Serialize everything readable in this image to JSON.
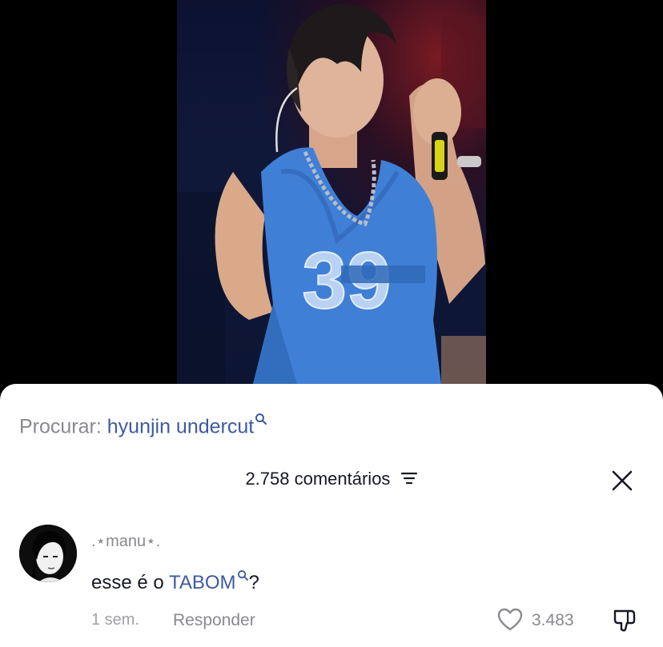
{
  "search": {
    "prefix": "Procurar:",
    "term": "hyunjin undercut"
  },
  "comments_header": {
    "count_label": "2.758 comentários"
  },
  "comment": {
    "username": ".⋆manu⋆.",
    "text_before": "esse é o ",
    "link": "TABOM",
    "text_after": "?",
    "time": "1 sem.",
    "reply_label": "Responder",
    "like_count": "3.483"
  },
  "colors": {
    "link": "#3e5aa0",
    "muted": "#8a8a8e",
    "video_bg": "#0d1533"
  },
  "icons": [
    "search-icon",
    "filter-icon",
    "close-icon",
    "heart-icon",
    "dislike-icon"
  ]
}
